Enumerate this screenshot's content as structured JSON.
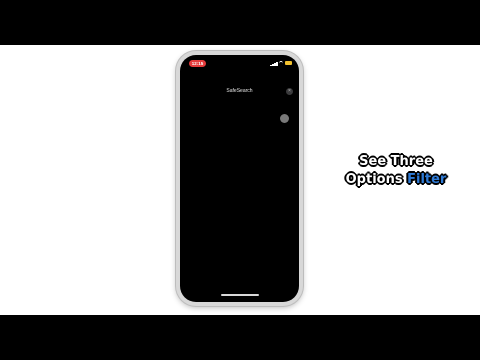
{
  "status_bar": {
    "time": "12:15"
  },
  "screen": {
    "nav_title": "SafeSearch",
    "close_glyph": "×"
  },
  "caption": {
    "line1": "See Three",
    "line2_prefix": "Options",
    "line2_highlight": "Filter"
  },
  "colors": {
    "time_pill": "#e53b3b",
    "battery": "#f2c230",
    "caption_highlight": "#2f7bd6"
  },
  "icons": [
    "signal-icon",
    "wifi-icon",
    "battery-icon",
    "close-icon"
  ]
}
